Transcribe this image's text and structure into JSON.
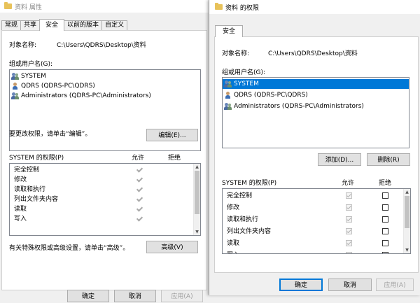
{
  "left": {
    "title": "资料 属性",
    "tabs": [
      "常规",
      "共享",
      "安全",
      "以前的版本",
      "自定义"
    ],
    "object_label": "对象名称:",
    "object_value": "C:\\Users\\QDRS\\Desktop\\资料",
    "group_label": "组或用户名(G):",
    "users": [
      "SYSTEM",
      "QDRS (QDRS-PC\\QDRS)",
      "Administrators (QDRS-PC\\Administrators)"
    ],
    "edit_hint": "要更改权限，请单击“编辑”。",
    "edit_button": "编辑(E)...",
    "perm_label": "SYSTEM 的权限(P)",
    "allow_label": "允许",
    "deny_label": "拒绝",
    "permissions": [
      "完全控制",
      "修改",
      "读取和执行",
      "列出文件夹内容",
      "读取",
      "写入"
    ],
    "adv_hint": "有关特殊权限或高级设置，请单击“高级”。",
    "adv_button": "高级(V)",
    "footer_buttons": [
      "确定",
      "取消",
      "应用(A)"
    ]
  },
  "right": {
    "title": "资料 的权限",
    "tab": "安全",
    "object_label": "对象名称:",
    "object_value": "C:\\Users\\QDRS\\Desktop\\资料",
    "group_label": "组或用户名(G):",
    "users": [
      "SYSTEM",
      "QDRS (QDRS-PC\\QDRS)",
      "Administrators (QDRS-PC\\Administrators)"
    ],
    "add_button": "添加(D)...",
    "remove_button": "删除(R)",
    "perm_label": "SYSTEM 的权限(P)",
    "allow_label": "允许",
    "deny_label": "拒绝",
    "permissions": [
      "完全控制",
      "修改",
      "读取和执行",
      "列出文件夹内容",
      "读取",
      "写入"
    ],
    "ok_button": "确定",
    "cancel_button": "取消",
    "apply_button": "应用(A)"
  }
}
